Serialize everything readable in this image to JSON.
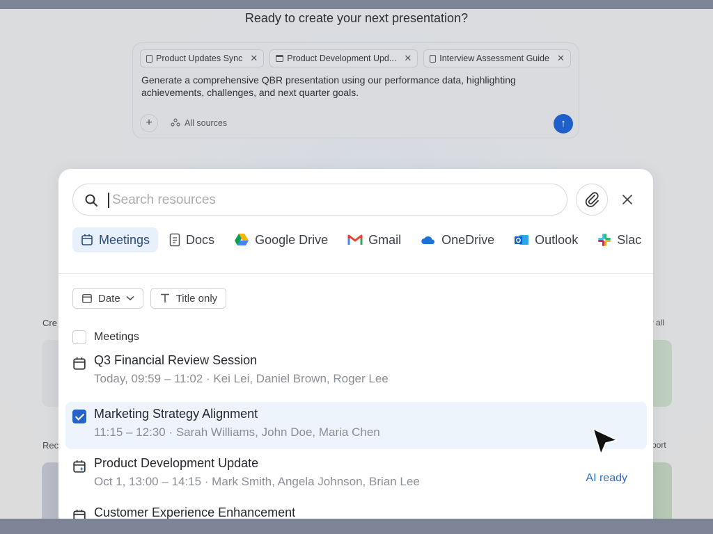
{
  "heading": "Ready to create your next presentation?",
  "composer": {
    "chips": [
      {
        "icon": "doc-icon",
        "label": "Product Updates Sync"
      },
      {
        "icon": "calendar-icon",
        "label": "Product Development Upd..."
      },
      {
        "icon": "doc-icon",
        "label": "Interview Assessment Guide"
      }
    ],
    "prompt": "Generate a comprehensive QBR presentation using our performance data, highlighting achievements, challenges, and next quarter goals.",
    "add_label": "+",
    "sources_label": "All sources",
    "send_label": "↑"
  },
  "background": {
    "left_label_1": "Cre",
    "right_label_1": "w all",
    "left_label_2": "Rec",
    "right_label_2": "port"
  },
  "search": {
    "placeholder": "Search resources",
    "value": ""
  },
  "tabs": [
    {
      "label": "Meetings",
      "icon": "calendar-icon",
      "active": true
    },
    {
      "label": "Docs",
      "icon": "doc-icon"
    },
    {
      "label": "Google Drive",
      "icon": "google-drive-icon"
    },
    {
      "label": "Gmail",
      "icon": "gmail-icon"
    },
    {
      "label": "OneDrive",
      "icon": "onedrive-icon"
    },
    {
      "label": "Outlook",
      "icon": "outlook-icon"
    },
    {
      "label": "Slac",
      "icon": "slack-icon"
    }
  ],
  "filters": {
    "date_label": "Date",
    "title_only_label": "Title only"
  },
  "group": {
    "label": "Meetings"
  },
  "items": [
    {
      "title": "Q3 Financial Review Session",
      "meta": "Today, 09:59 – 11:02 · Kei Lei, Daniel Brown, Roger Lee",
      "checked": false,
      "tag": ""
    },
    {
      "title": "Marketing Strategy Alignment",
      "meta": "11:15 – 12:30 · Sarah Williams, John Doe, Maria Chen",
      "checked": true,
      "tag": ""
    },
    {
      "title": "Product Development Update",
      "meta": "Oct 1, 13:00 – 14:15 · Mark Smith, Angela Johnson, Brian Lee",
      "checked": false,
      "tag": "AI ready"
    },
    {
      "title": "Customer Experience Enhancement",
      "meta": "",
      "checked": false,
      "tag": ""
    }
  ],
  "colors": {
    "accent": "#2563c9",
    "selected_row": "#eef4fb",
    "active_tab": "#e8f0fb",
    "ai_tag": "#2d6cc4"
  }
}
